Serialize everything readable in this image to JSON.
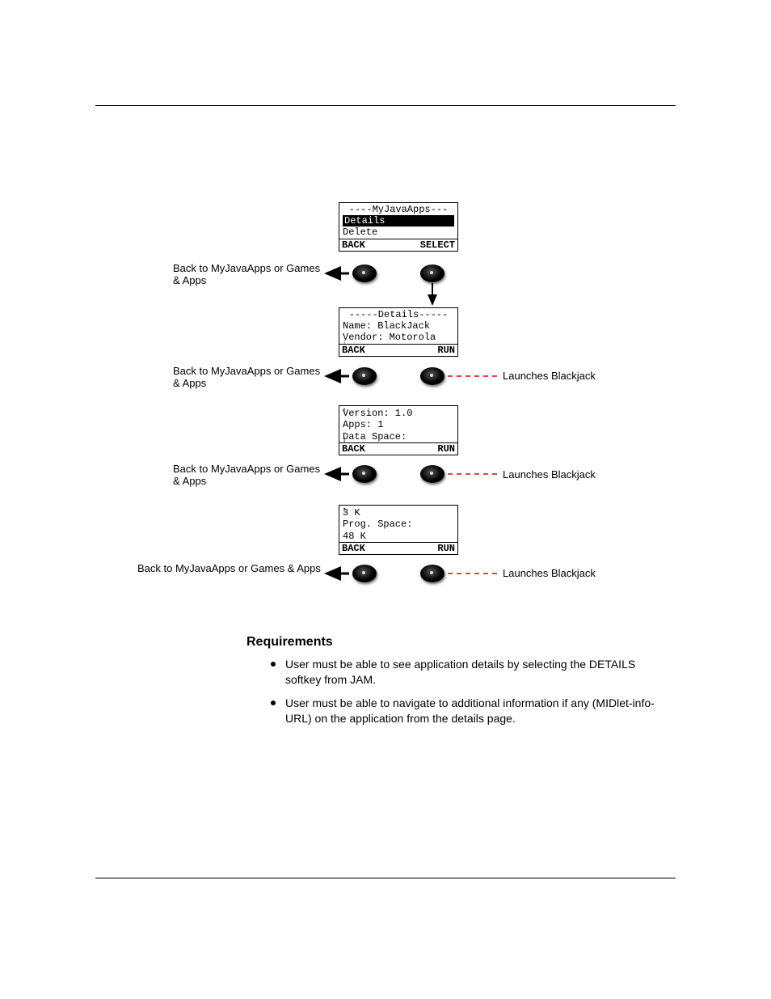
{
  "header": {
    "left": "",
    "right": ""
  },
  "footer": {
    "page": "",
    "version": ""
  },
  "screens": {
    "s1": {
      "title": "----MyJavaApps---",
      "row_a": "Details",
      "row_b": "Delete",
      "sk_left": "BACK",
      "sk_right": "SELECT"
    },
    "s2": {
      "title": "-----Details-----",
      "row_a": "Name: BlackJack",
      "row_b": "Vendor: Motorola",
      "sk_left": "BACK",
      "sk_right": "RUN"
    },
    "s3": {
      "row_a": "Version: 1.0",
      "row_b": "Apps: 1",
      "row_c": "Data Space:",
      "sk_left": "BACK",
      "sk_right": "RUN"
    },
    "s4": {
      "row_a": "3 K",
      "row_b": "Prog. Space:",
      "row_c": "48 K",
      "sk_left": "BACK",
      "sk_right": "RUN"
    }
  },
  "labels": {
    "back1": "Back to MyJavaApps or Games & Apps",
    "back2": "Back to MyJavaApps or Games & Apps",
    "back3": "Back to MyJavaApps or Games & Apps",
    "back4": "Back to MyJavaApps or Games & Apps",
    "launch1": "Launches Blackjack",
    "launch2": "Launches Blackjack",
    "launch3": "Launches Blackjack"
  },
  "section": {
    "title": "Requirements",
    "b1": "User must be able to see application details by selecting the DETAILS softkey from JAM.",
    "b2": "User must be able to navigate to additional information if any (MIDlet-info-URL) on the application from the details page."
  }
}
